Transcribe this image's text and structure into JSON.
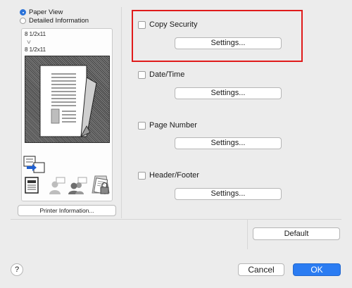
{
  "view_mode": {
    "options": [
      {
        "label": "Paper View",
        "selected": true
      },
      {
        "label": "Detailed Information",
        "selected": false
      }
    ]
  },
  "preview": {
    "original_size": "8 1/2x11",
    "output_size": "8 1/2x11",
    "icons": [
      "fax-send-icon",
      "document-icon",
      "user-icon",
      "users-icon",
      "secure-document-icon"
    ]
  },
  "printer_info_label": "Printer Information...",
  "options": [
    {
      "label": "Copy Security",
      "checked": false,
      "button": "Settings..."
    },
    {
      "label": "Date/Time",
      "checked": false,
      "button": "Settings..."
    },
    {
      "label": "Page Number",
      "checked": false,
      "button": "Settings..."
    },
    {
      "label": "Header/Footer",
      "checked": false,
      "button": "Settings..."
    }
  ],
  "default_label": "Default",
  "help_label": "?",
  "cancel_label": "Cancel",
  "ok_label": "OK",
  "colors": {
    "highlight": "#e01b1b",
    "accent": "#2b7cf2"
  }
}
